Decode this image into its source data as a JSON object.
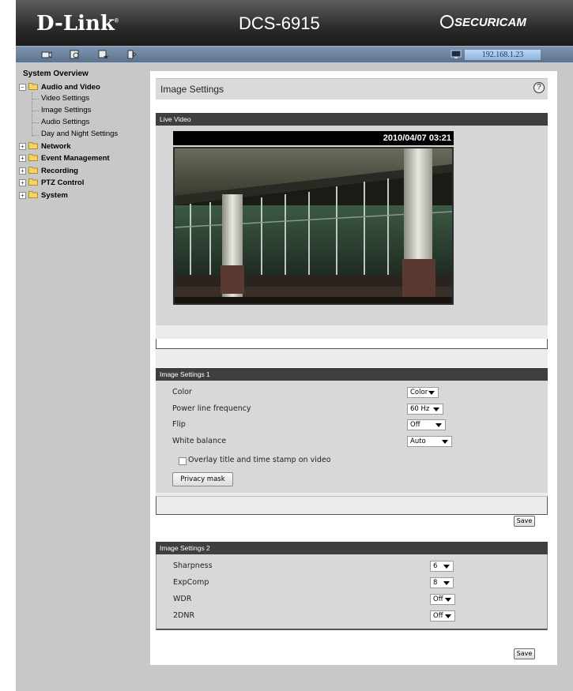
{
  "header": {
    "logo": "D-Link",
    "logo_tm": "®",
    "model": "DCS-6915",
    "brand": "SECURICAM"
  },
  "toolbar": {
    "icons": [
      "camera-icon",
      "live-view-icon",
      "settings-icon",
      "logout-icon"
    ],
    "ip_address": "192.168.1.23"
  },
  "sidebar": {
    "title": "System Overview",
    "nodes": [
      {
        "label": "Audio and Video",
        "expanded": true,
        "children": [
          "Video Settings",
          "Image Settings",
          "Audio Settings",
          "Day and Night Settings"
        ]
      },
      {
        "label": "Network",
        "expanded": false
      },
      {
        "label": "Event Management",
        "expanded": false
      },
      {
        "label": "Recording",
        "expanded": false
      },
      {
        "label": "PTZ Control",
        "expanded": false
      },
      {
        "label": "System",
        "expanded": false
      }
    ]
  },
  "page": {
    "title": "Image Settings",
    "help": "?"
  },
  "live_video": {
    "header": "Live Video",
    "timestamp": "2010/04/07 03:21"
  },
  "image_settings_1": {
    "header": "Image Settings 1",
    "color_label": "Color",
    "color_value": "Color",
    "power_label": "Power line frequency",
    "power_value": "60 Hz",
    "flip_label": "Flip",
    "flip_value": "Off",
    "wb_label": "White balance",
    "wb_value": "Auto",
    "overlay_label": "Overlay title and time stamp on video",
    "overlay_checked": false,
    "privacy_button": "Privacy mask",
    "save_label": "Save"
  },
  "image_settings_2": {
    "header": "Image Settings 2",
    "sharpness_label": "Sharpness",
    "sharpness_value": "6",
    "expcomp_label": "ExpComp",
    "expcomp_value": "8",
    "wdr_label": "WDR",
    "wdr_value": "Off",
    "dnr_label": "2DNR",
    "dnr_value": "Off",
    "save_label": "Save"
  },
  "colors": {
    "header_bg": "#2c2c2c",
    "toolbar_bg": "#6b82a0",
    "section_header_bg": "#3f3f3f",
    "panel_bg": "#d8d8d8"
  }
}
